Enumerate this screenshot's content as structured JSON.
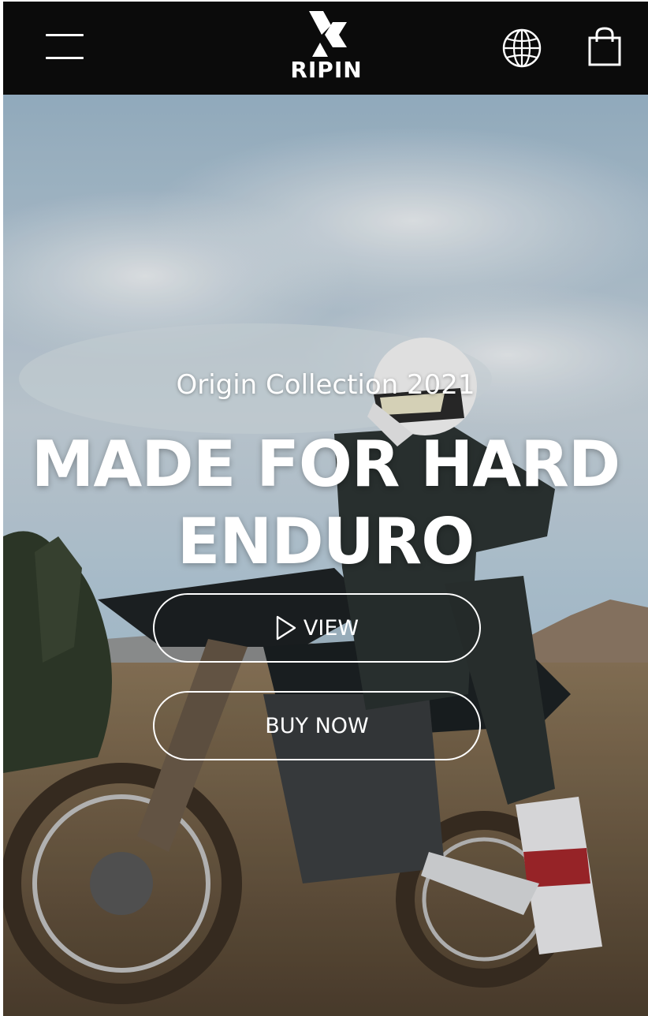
{
  "header": {
    "brand": "RIPIN",
    "icons": {
      "menu": "hamburger-menu-icon",
      "logo_mark": "ripin-logo-mark",
      "language": "globe-icon",
      "cart": "shopping-bag-icon"
    }
  },
  "hero": {
    "eyebrow": "Origin Collection 2021",
    "headline": "MADE FOR HARD ENDURO",
    "buttons": {
      "view_label": "VIEW",
      "buy_label": "BUY NOW"
    },
    "icons": {
      "play": "play-icon"
    }
  },
  "colors": {
    "header_bg": "#0b0b0b",
    "text": "#ffffff",
    "sky": "#a9c4d8",
    "ground": "#6e5a42"
  }
}
